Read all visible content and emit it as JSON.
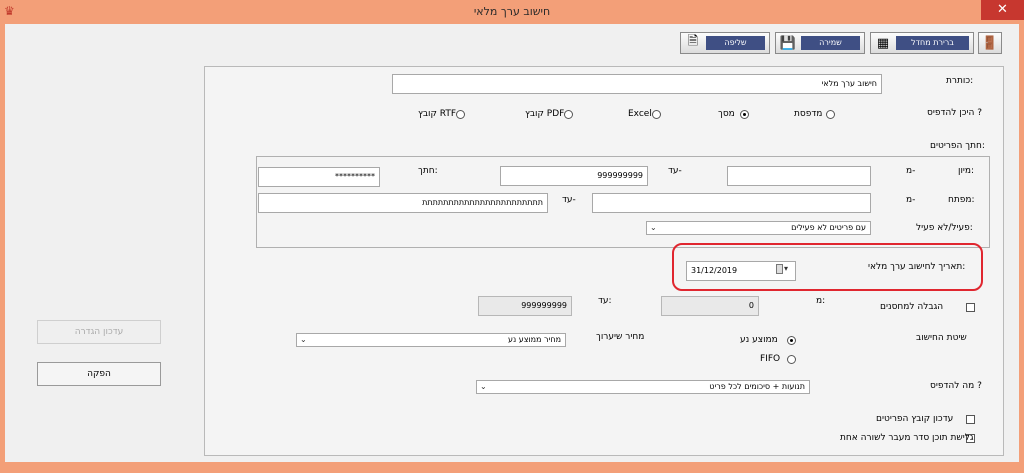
{
  "window": {
    "title": "חישוב ערך מלאי",
    "close": "✕"
  },
  "toolbar": {
    "exit_icon": "door-exit-icon",
    "choose_default": "ברירת מחדל",
    "save": "שמירה",
    "load": "שליפה"
  },
  "header": {
    "label": "כותרת:",
    "value": "חישוב ערך מלאי"
  },
  "print_target": {
    "label": "היכן להדפיס ?",
    "options": [
      "מדפסת",
      "מסך",
      "Excel",
      "קובץ PDF",
      "קובץ RTF"
    ],
    "selected": "מסך"
  },
  "item_filter_label": "חתך הפריטים:",
  "filters": {
    "sort_label": "מיון:",
    "from": "מ-",
    "to": "עד-",
    "sort_to_value": "999999999",
    "slice_label": "חתך:",
    "slice_value": "**********",
    "key_label": "מפתח:",
    "key_to_value": "תתתתתתתתתתתתתתתתתתתתתתת",
    "active_label": "פעיל/לא פעיל:",
    "active_value": "עם פריטים לא פעילים"
  },
  "date": {
    "label": "תאריך לחישוב ערך מלאי:",
    "value": "31/12/2019"
  },
  "warehouse": {
    "label": "הגבלה למחסנים",
    "from": "מ:",
    "from_value": "0",
    "to": "עד:",
    "to_value": "999999999"
  },
  "calc_method": {
    "label": "שיטת החישוב",
    "options": [
      "ממוצע נע",
      "FIFO"
    ],
    "selected": "ממוצע נע",
    "revaluation_label": "מחיר שיערוך",
    "revaluation_value": "מחיר ממוצע נע"
  },
  "what_to_print": {
    "label": "מה להדפיס ?",
    "value": "תנועות + סיכומים לכל פריט"
  },
  "options": {
    "update_items_file": "עדכון קובץ הפריטים",
    "scroll_content": "גלישת תוכן סדר מעבר לשורה אחת"
  },
  "side": {
    "update_definition": "עדכון הגדרה",
    "produce": "הפקה"
  }
}
